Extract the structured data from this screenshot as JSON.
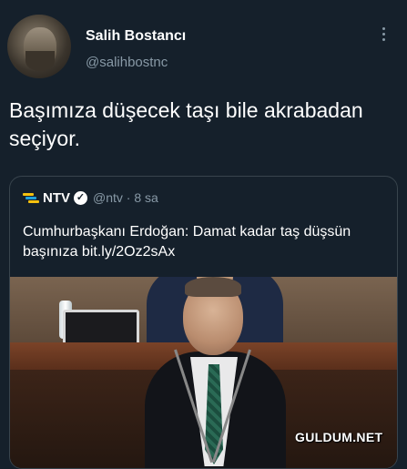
{
  "author": {
    "name": "Salih Bostancı",
    "handle": "@salihbostnc"
  },
  "tweet": {
    "text": "Başımıza düşecek taşı bile akrabadan seçiyor."
  },
  "quoted": {
    "name": "NTV",
    "handle_time": "@ntv · 8 sa",
    "text": "Cumhurbaşkanı Erdoğan: Damat kadar taş düşsün başınıza bit.ly/2Oz2sAx",
    "verified_mark": "✓"
  },
  "watermark": "GULDUM.NET",
  "colors": {
    "background": "#15202b",
    "secondary_text": "#8899a6",
    "border": "#38444d"
  },
  "icons": [
    "more-vertical-icon",
    "ntv-logo-icon",
    "verified-badge-icon"
  ]
}
